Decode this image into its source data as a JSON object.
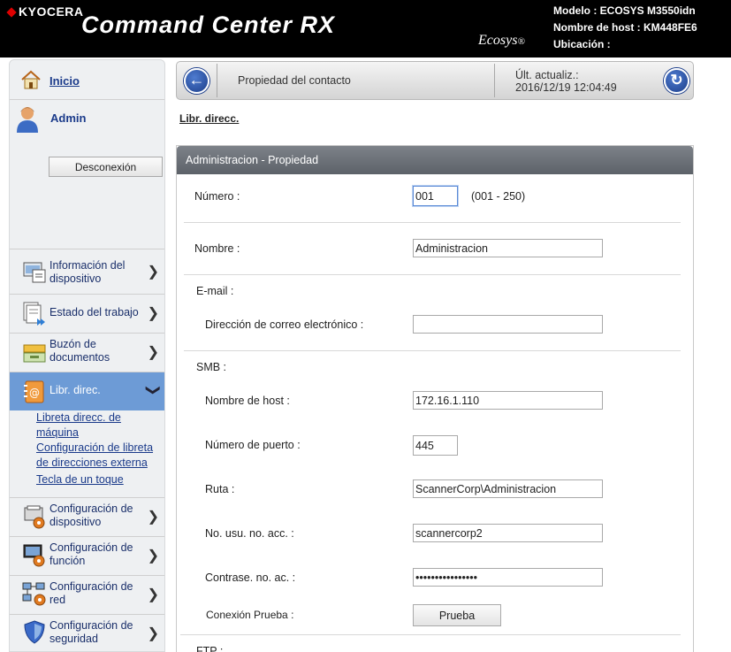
{
  "header": {
    "brand": "KYOCERA",
    "app_title": "Command Center RX",
    "ecosys_logo": "Ecosys",
    "model_line": "Modelo : ECOSYS M3550idn",
    "host_line": "Nombre de host : KM448FE6",
    "location_line": "Ubicación :"
  },
  "sidebar": {
    "home_label": "Inicio",
    "user_label": "Admin",
    "logout_label": "Desconexión",
    "menu": [
      {
        "label_1": "Información del",
        "label_2": "dispositivo"
      },
      {
        "label_1": "Estado del trabajo",
        "label_2": ""
      },
      {
        "label_1": "Buzón de",
        "label_2": "documentos"
      },
      {
        "label_1": "Libr. direc.",
        "label_2": ""
      },
      {
        "label_1": "Configuración de",
        "label_2": "dispositivo"
      },
      {
        "label_1": "Configuración de",
        "label_2": "función"
      },
      {
        "label_1": "Configuración de",
        "label_2": "red"
      },
      {
        "label_1": "Configuración de",
        "label_2": "seguridad"
      }
    ],
    "submenu": [
      {
        "line_1": "Libreta direcc. de",
        "line_2": "máquina"
      },
      {
        "line_1": "Configuración de libreta",
        "line_2": "de direcciones externa"
      },
      {
        "line_1": "Tecla de un toque",
        "line_2": ""
      }
    ]
  },
  "topbar": {
    "title": "Propiedad del contacto",
    "update_label": "Últ. actualiz.:",
    "update_time": "2016/12/19 12:04:49"
  },
  "breadcrumb": "Libr. direcc.",
  "panel": {
    "header": "Administracion - Propiedad",
    "number_label": "Número :",
    "number_value": "001",
    "number_range": "(001 - 250)",
    "name_label": "Nombre :",
    "name_value": "Administracion",
    "email_section": "E-mail :",
    "email_label": "Dirección de correo electrónico :",
    "email_value": "",
    "smb_section": "SMB :",
    "host_label": "Nombre de host :",
    "host_value": "172.16.1.110",
    "port_label": "Número de puerto :",
    "port_value": "445",
    "path_label": "Ruta :",
    "path_value": "ScannerCorp\\Administracion",
    "login_label": "No. usu. no. acc. :",
    "login_value": "scannercorp2",
    "password_label": "Contrase. no. ac. :",
    "password_value": "••••••••••••••••",
    "test_label": "Conexión Prueba :",
    "test_button": "Prueba",
    "ftp_section": "FTP :"
  }
}
